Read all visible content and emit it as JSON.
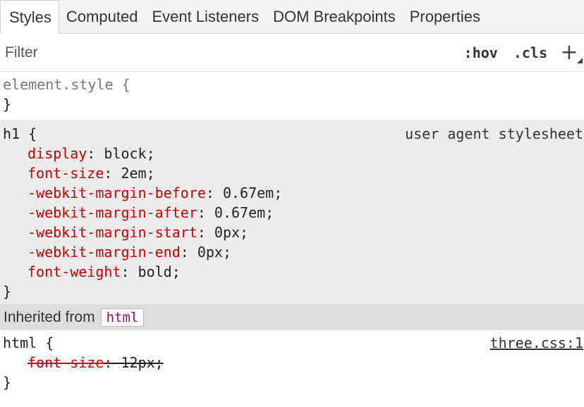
{
  "tabs": [
    {
      "label": "Styles",
      "active": true
    },
    {
      "label": "Computed"
    },
    {
      "label": "Event Listeners"
    },
    {
      "label": "DOM Breakpoints"
    },
    {
      "label": "Properties"
    }
  ],
  "filter": {
    "placeholder": "Filter",
    "hov_label": ":hov",
    "cls_label": ".cls",
    "add_label": "+"
  },
  "element_style": {
    "selector": "element.style {",
    "close": "}"
  },
  "ua_rule": {
    "selector": "h1 {",
    "source": "user agent stylesheet",
    "close": "}",
    "declarations": [
      {
        "name": "display",
        "value": "block;"
      },
      {
        "name": "font-size",
        "value": "2em;"
      },
      {
        "name": "-webkit-margin-before",
        "value": "0.67em;"
      },
      {
        "name": "-webkit-margin-after",
        "value": "0.67em;"
      },
      {
        "name": "-webkit-margin-start",
        "value": "0px;"
      },
      {
        "name": "-webkit-margin-end",
        "value": "0px;"
      },
      {
        "name": "font-weight",
        "value": "bold;"
      }
    ]
  },
  "inherited": {
    "label": "Inherited from",
    "tag": "html"
  },
  "html_rule": {
    "selector": "html {",
    "source": "three.css:1",
    "close": "}",
    "declarations": [
      {
        "name": "font-size",
        "value": "12px;",
        "overridden": true
      }
    ]
  },
  "colors": {
    "property_name": "#c80000",
    "inherited_tag": "#881280",
    "ua_background": "#ececec"
  }
}
